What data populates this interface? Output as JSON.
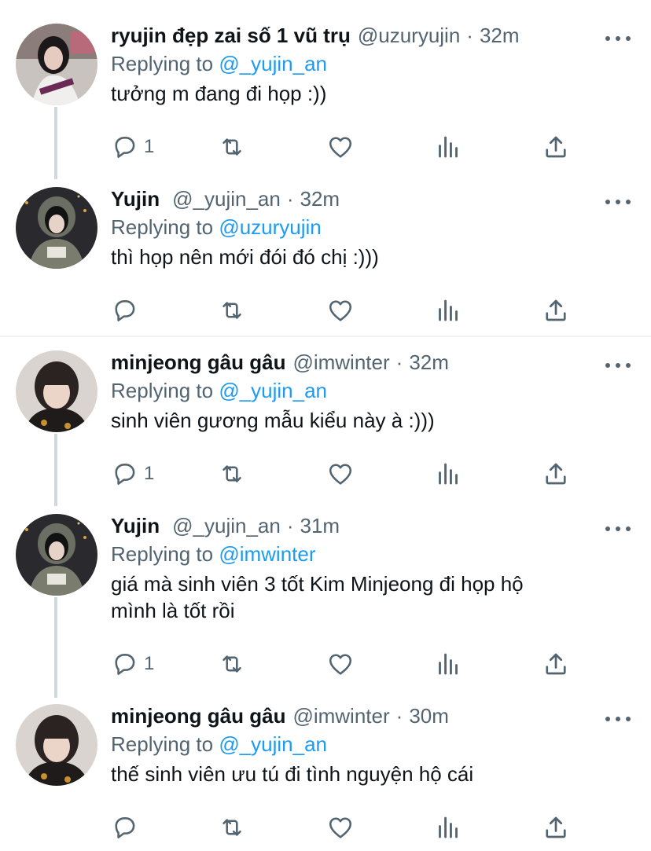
{
  "tweets": [
    {
      "name": "ryujin đẹp zai số 1 vũ trụ",
      "handle": "@uzuryujin",
      "dot": "·",
      "time": "32m",
      "replying_prefix": "Replying to",
      "replying_to": "@_yujin_an",
      "text": "tưởng m đang đi họp :))",
      "reply_count": "1",
      "avatar": "avatar-ryujin"
    },
    {
      "name": "Yujin",
      "handle": "@_yujin_an",
      "dot": "·",
      "time": "32m",
      "replying_prefix": "Replying to",
      "replying_to": "@uzuryujin",
      "text": "thì họp nên mới đói đó chị :)))",
      "reply_count": "",
      "avatar": "avatar-yujin"
    },
    {
      "name": "minjeong gâu gâu",
      "handle": "@imwinter",
      "dot": "·",
      "time": "32m",
      "replying_prefix": "Replying to",
      "replying_to": "@_yujin_an",
      "text": "sinh viên gương mẫu kiểu này à :)))",
      "reply_count": "1",
      "avatar": "avatar-minjeong"
    },
    {
      "name": "Yujin",
      "handle": "@_yujin_an",
      "dot": "·",
      "time": "31m",
      "replying_prefix": "Replying to",
      "replying_to": "@imwinter",
      "text_line1": "giá mà sinh viên 3 tốt Kim Minjeong đi họp hộ",
      "text_line2": "mình là tốt rồi",
      "reply_count": "1",
      "avatar": "avatar-yujin"
    },
    {
      "name": "minjeong gâu gâu",
      "handle": "@imwinter",
      "dot": "·",
      "time": "30m",
      "replying_prefix": "Replying to",
      "replying_to": "@_yujin_an",
      "text": "thế sinh viên ưu tú đi tình nguyện hộ cái",
      "reply_count": "",
      "avatar": "avatar-minjeong"
    }
  ],
  "icons": {
    "reply": "reply-icon",
    "retweet": "retweet-icon",
    "like": "heart-icon",
    "analytics": "analytics-icon",
    "share": "share-icon",
    "more": "more-icon"
  },
  "colors": {
    "text": "#0f1419",
    "secondary": "#536471",
    "link": "#1d9bf0",
    "thread_line": "#cfd9de",
    "divider": "#eff3f4"
  }
}
